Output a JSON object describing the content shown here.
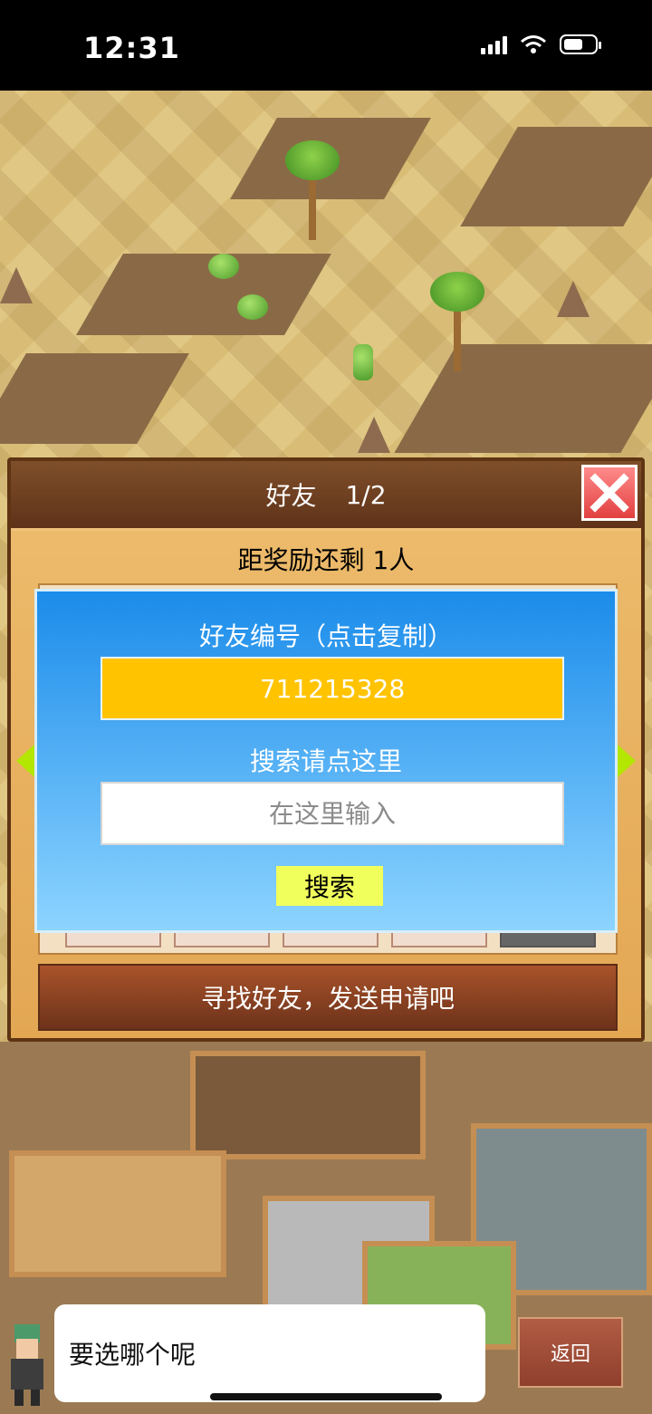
{
  "status_bar": {
    "time": "12:31",
    "icons": [
      "signal-icon",
      "wifi-icon",
      "battery-icon"
    ]
  },
  "dialog": {
    "title": "好友",
    "page": "1/2",
    "reward_text": "距奖励还剩 1人",
    "close_icon": "close-icon"
  },
  "search_panel": {
    "id_label": "好友编号（点击复制）",
    "friend_id": "711215328",
    "search_label": "搜索请点这里",
    "search_placeholder": "在这里输入",
    "search_button": "搜索"
  },
  "find_friend_button": "寻找好友，发送申请吧",
  "bottom": {
    "speech_text": "要选哪个呢",
    "back_button": "返回"
  },
  "colors": {
    "dialog_header": "#6b3a1f",
    "id_box": "#ffc300",
    "search_button": "#f1ff5c",
    "panel_top": "#1b8cea",
    "nav_arrow": "#b3e600"
  }
}
